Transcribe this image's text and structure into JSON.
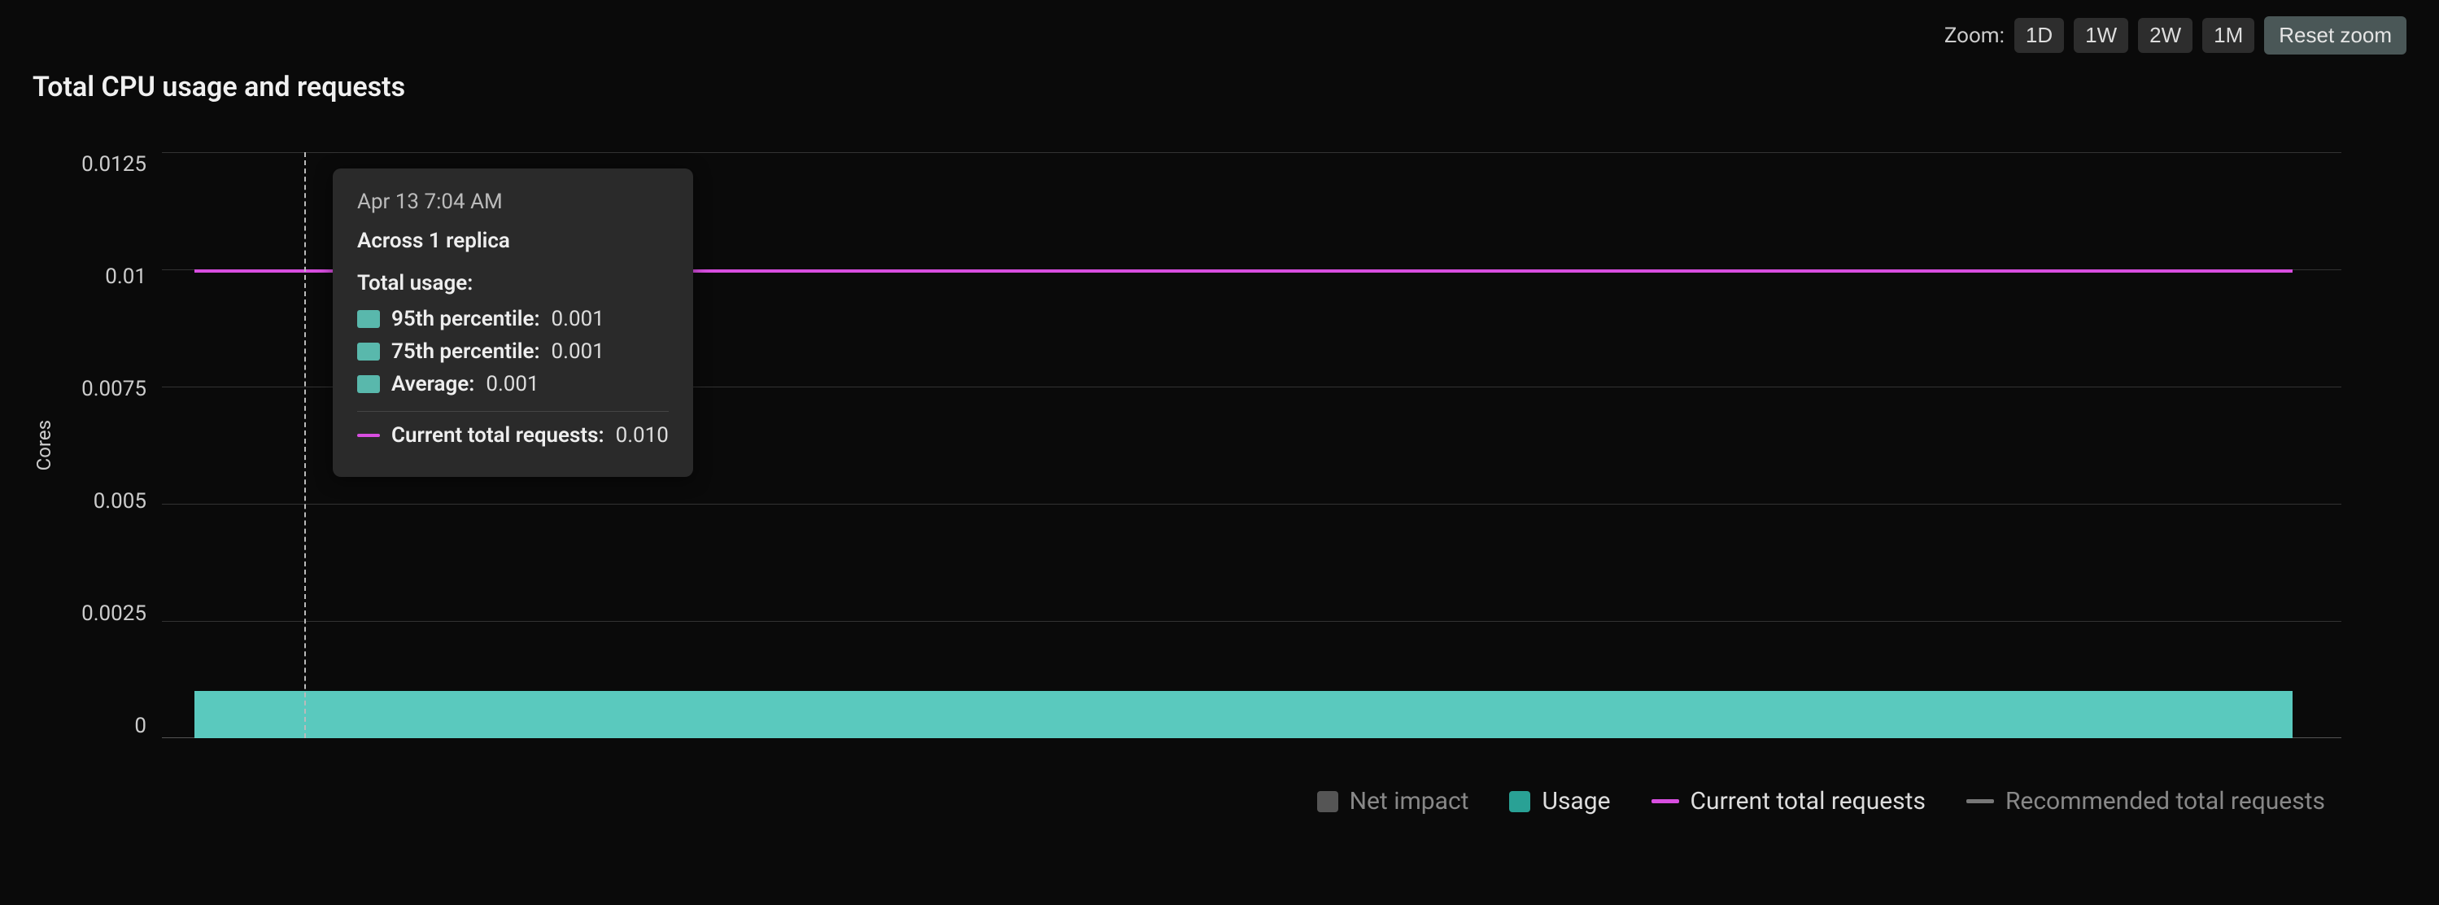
{
  "controls": {
    "zoom_label": "Zoom:",
    "ranges": [
      "1D",
      "1W",
      "2W",
      "1M"
    ],
    "reset_label": "Reset zoom"
  },
  "title": "Total CPU usage and requests",
  "axes": {
    "y_label": "Cores",
    "y_ticks": [
      "0.0125",
      "0.01",
      "0.0075",
      "0.005",
      "0.0025",
      "0"
    ]
  },
  "tooltip": {
    "timestamp": "Apr 13 7:04 AM",
    "heading": "Across 1 replica",
    "section_label": "Total usage:",
    "rows": [
      {
        "label": "95th percentile:",
        "value": "0.001"
      },
      {
        "label": "75th percentile:",
        "value": "0.001"
      },
      {
        "label": "Average:",
        "value": "0.001"
      }
    ],
    "requests_label": "Current total requests:",
    "requests_value": "0.010"
  },
  "legend": {
    "net_impact": "Net impact",
    "usage": "Usage",
    "current_requests": "Current total requests",
    "recommended_requests": "Recommended total requests"
  },
  "chart_data": {
    "type": "area",
    "title": "Total CPU usage and requests",
    "ylabel": "Cores",
    "ylim": [
      0,
      0.0125
    ],
    "series": [
      {
        "name": "Usage (95th percentile)",
        "type": "area",
        "values": [
          0.001,
          0.001,
          0.001,
          0.001,
          0.001
        ],
        "color": "#5fd4c8"
      },
      {
        "name": "Usage (75th percentile)",
        "type": "area",
        "values": [
          0.001,
          0.001,
          0.001,
          0.001,
          0.001
        ],
        "color": "#5fd4c8"
      },
      {
        "name": "Usage (Average)",
        "type": "area",
        "values": [
          0.001,
          0.001,
          0.001,
          0.001,
          0.001
        ],
        "color": "#5fd4c8"
      },
      {
        "name": "Current total requests",
        "type": "line",
        "values": [
          0.01,
          0.01,
          0.01,
          0.01,
          0.01
        ],
        "color": "#d84ee0"
      }
    ],
    "hover_point": {
      "timestamp": "Apr 13 7:04 AM",
      "replicas": 1,
      "usage_p95": 0.001,
      "usage_p75": 0.001,
      "usage_avg": 0.001,
      "current_total_requests": 0.01
    }
  }
}
